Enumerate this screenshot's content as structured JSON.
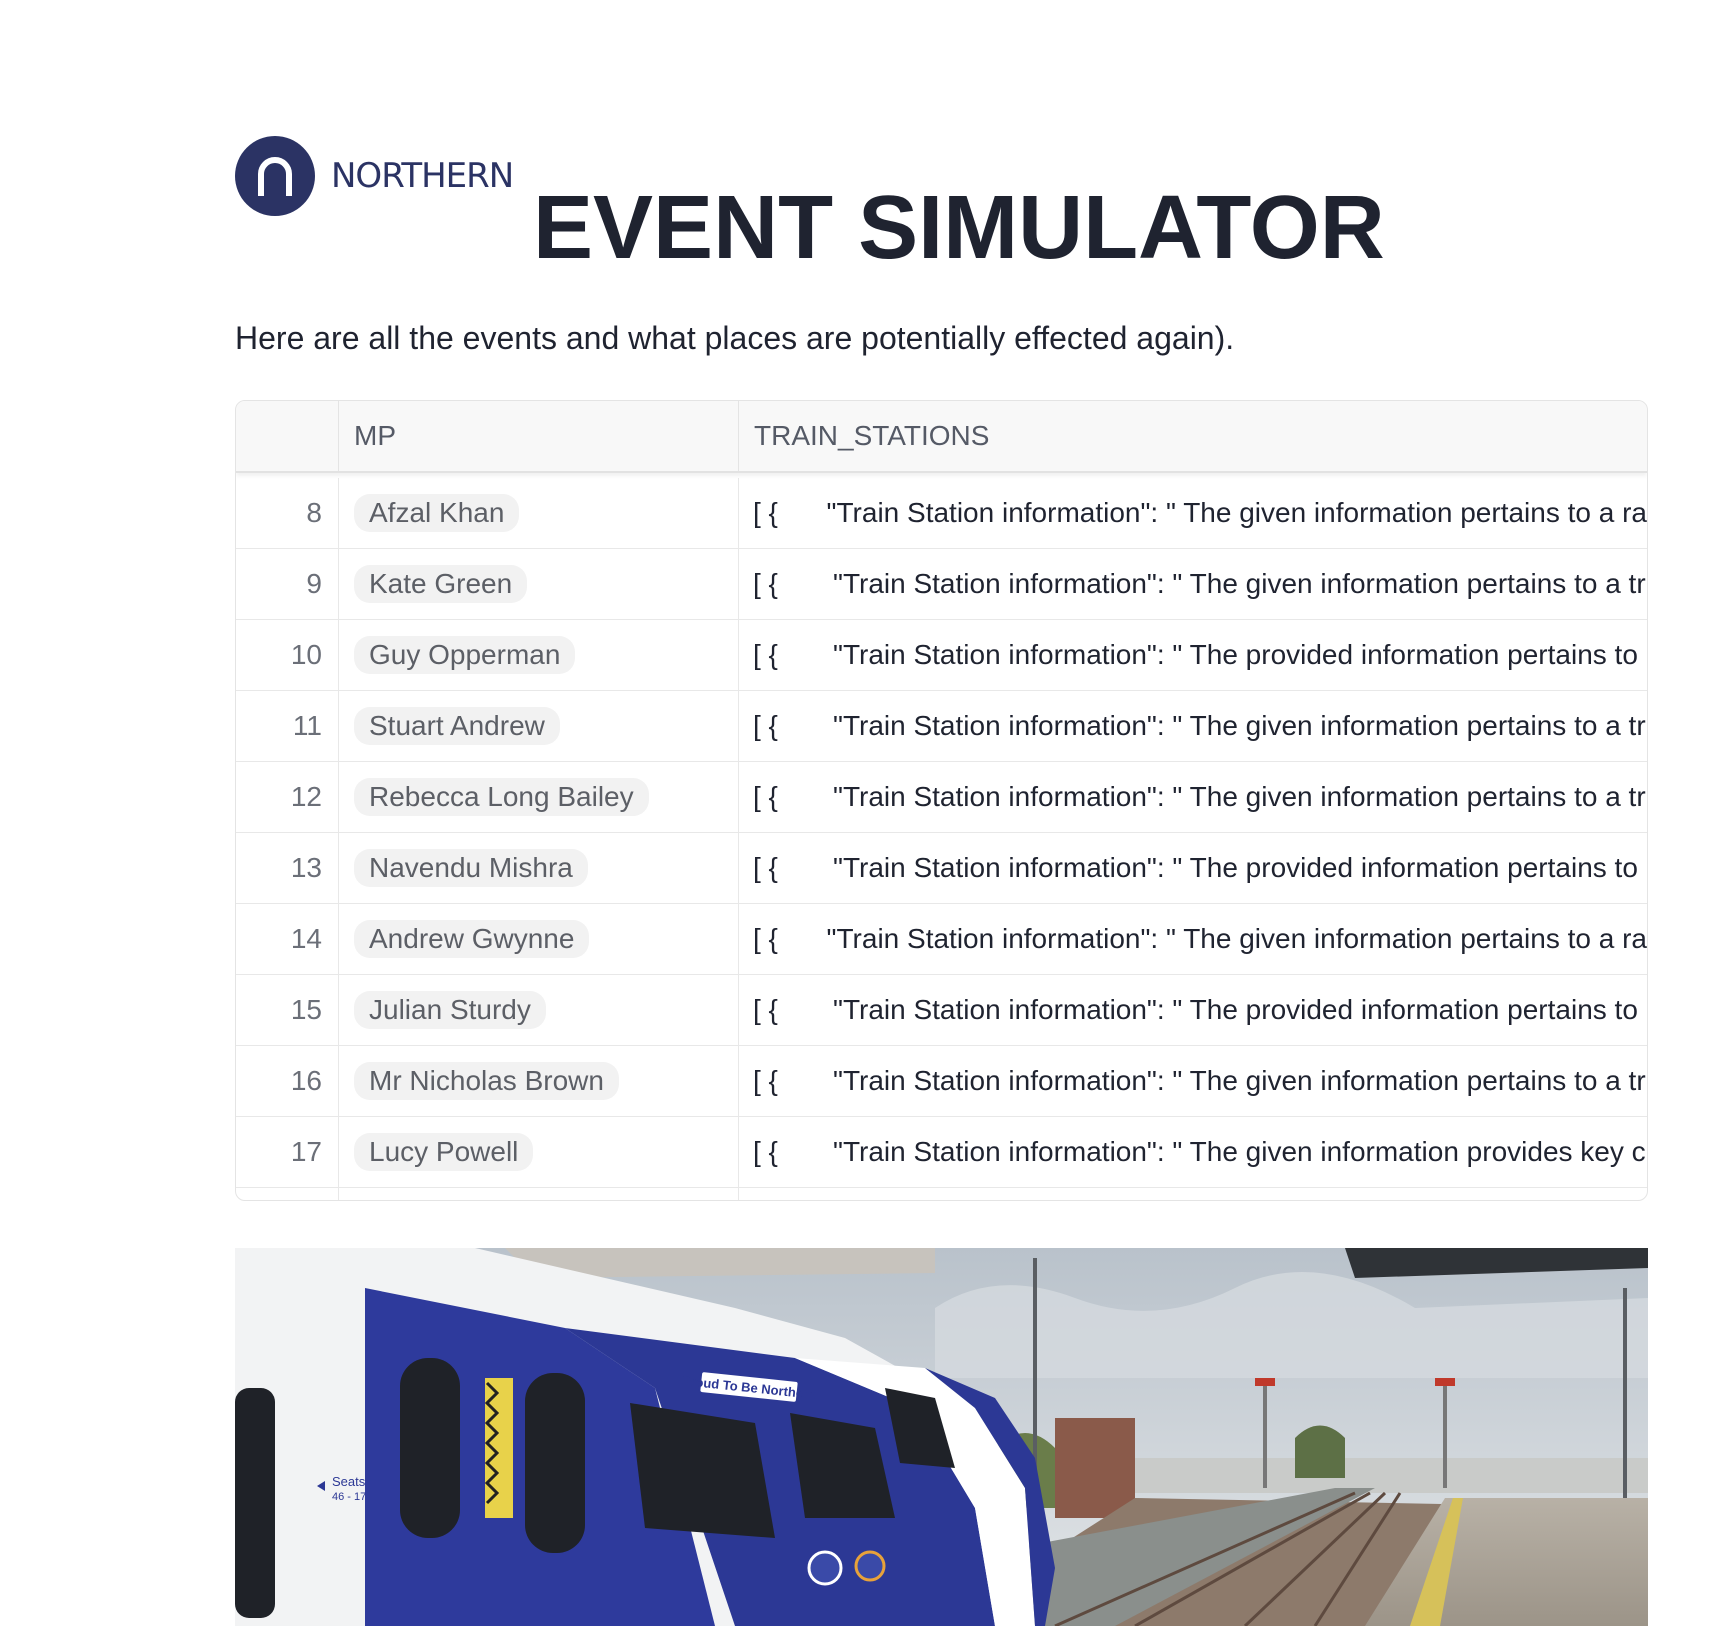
{
  "brand": {
    "name": "NORTHERN",
    "color": "#2b3364"
  },
  "title": "EVENT SIMULATOR",
  "intro": "Here are all the events and what places are potentially effected again).",
  "table": {
    "columns": [
      "",
      "MP",
      "TRAIN_STATIONS"
    ],
    "rows": [
      {
        "index": "8",
        "mp": "Afzal Khan",
        "brackets": "[  {",
        "stations": "\"Train Station information\": \" The given information pertains to a ra"
      },
      {
        "index": "9",
        "mp": "Kate Green",
        "brackets": "[  {",
        "stations": "\"Train Station information\": \" The given information pertains to a tr"
      },
      {
        "index": "10",
        "mp": "Guy Opperman",
        "brackets": "[  {",
        "stations": "\"Train Station information\": \" The provided information pertains to"
      },
      {
        "index": "11",
        "mp": "Stuart Andrew",
        "brackets": "[  {",
        "stations": "\"Train Station information\": \" The given information pertains to a tr"
      },
      {
        "index": "12",
        "mp": "Rebecca Long Bailey",
        "brackets": "[  {",
        "stations": "\"Train Station information\": \" The given information pertains to a tr"
      },
      {
        "index": "13",
        "mp": "Navendu Mishra",
        "brackets": "[  {",
        "stations": "\"Train Station information\": \" The provided information pertains to"
      },
      {
        "index": "14",
        "mp": "Andrew Gwynne",
        "brackets": "[  {",
        "stations": "\"Train Station information\": \" The given information pertains to a ra"
      },
      {
        "index": "15",
        "mp": "Julian Sturdy",
        "brackets": "[  {",
        "stations": "\"Train Station information\": \" The provided information pertains to"
      },
      {
        "index": "16",
        "mp": "Mr Nicholas Brown",
        "brackets": "[  {",
        "stations": "\"Train Station information\": \" The given information pertains to a tr"
      },
      {
        "index": "17",
        "mp": "Lucy Powell",
        "brackets": "[  {",
        "stations": "\"Train Station information\": \" The given information provides key c"
      }
    ]
  },
  "photo": {
    "sign_text": "Proud To Be Northern",
    "seats_label": "Seats",
    "seats_range": "46 - 17"
  }
}
